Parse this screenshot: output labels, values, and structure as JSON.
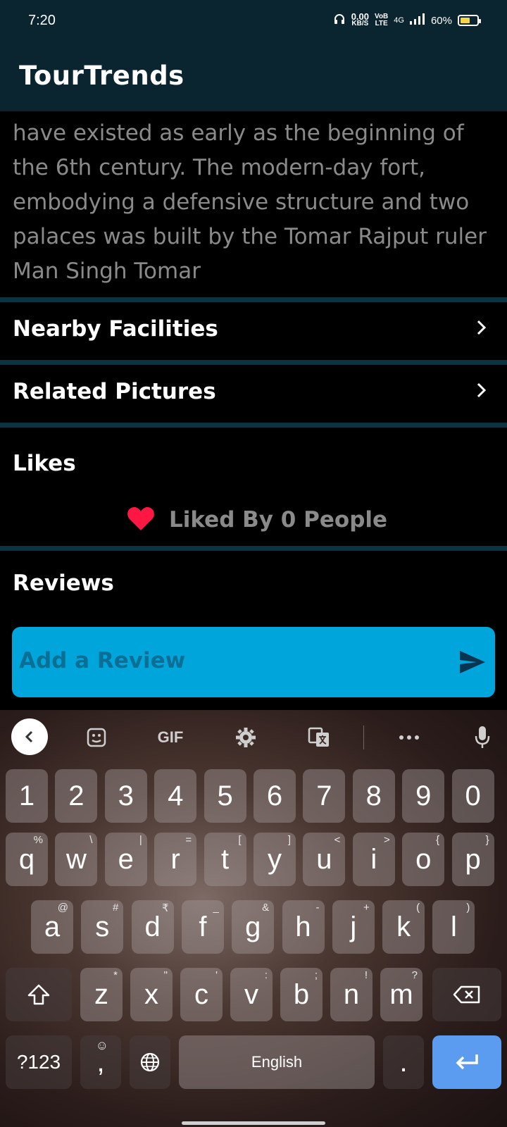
{
  "status_bar": {
    "time": "7:20",
    "net_speed": "0.00",
    "net_speed_unit": "KB/S",
    "volte": "VoB",
    "volte_sub": "LTE",
    "network": "4G",
    "battery": "60%",
    "battery_level": 0.6
  },
  "app": {
    "title": "TourTrends"
  },
  "description": {
    "text": "have existed as early as the beginning of the 6th century. The modern-day fort, embodying a defensive structure and two palaces was built by the Tomar Rajput ruler Man Singh Tomar"
  },
  "sections": {
    "nearby": "Nearby Facilities",
    "pictures": "Related Pictures",
    "likes": "Likes",
    "likes_text": "Liked By 0 People",
    "reviews": "Reviews"
  },
  "review": {
    "placeholder": "Add a Review"
  },
  "keyboard": {
    "toolbar": {
      "gif": "GIF"
    },
    "numbers": [
      "1",
      "2",
      "3",
      "4",
      "5",
      "6",
      "7",
      "8",
      "9",
      "0"
    ],
    "row1": [
      "q",
      "w",
      "e",
      "r",
      "t",
      "y",
      "u",
      "i",
      "o",
      "p"
    ],
    "row1_sup": [
      "%",
      "\\",
      "|",
      "=",
      "[",
      "]",
      "<",
      ">",
      "{",
      "}"
    ],
    "row2": [
      "a",
      "s",
      "d",
      "f",
      "g",
      "h",
      "j",
      "k",
      "l"
    ],
    "row2_sup": [
      "@",
      "#",
      "₹",
      "_",
      "&",
      "-",
      "+",
      "(",
      ")"
    ],
    "row3": [
      "z",
      "x",
      "c",
      "v",
      "b",
      "n",
      "m"
    ],
    "row3_sup": [
      "*",
      "\"",
      "'",
      ":",
      ";",
      "!",
      "?"
    ],
    "symbols_key": "?123",
    "comma": ",",
    "space": "English",
    "period": "."
  },
  "colors": {
    "appbar": "#0a2430",
    "divider": "#0d3342",
    "review_box": "#00a6db",
    "heart": "#ff1744",
    "enter_key": "#5b9bf0"
  }
}
